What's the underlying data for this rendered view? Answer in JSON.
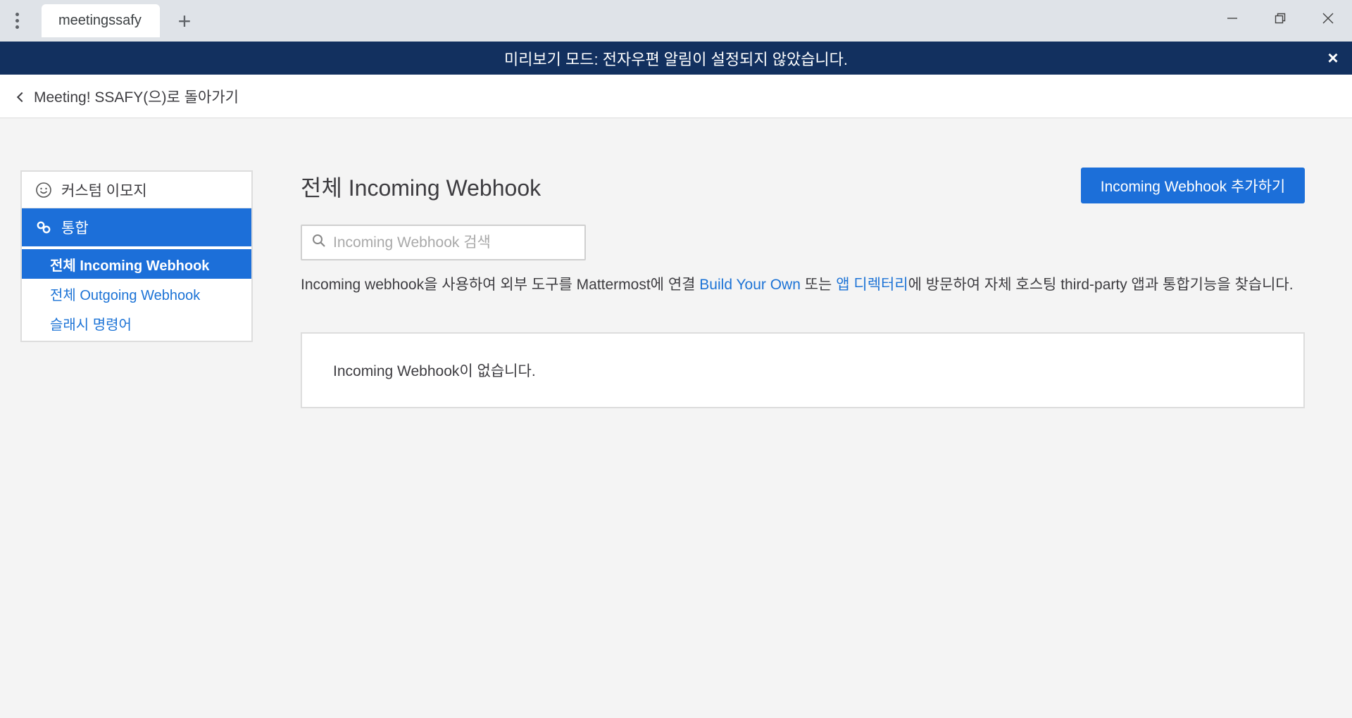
{
  "window": {
    "tab_title": "meetingssafy",
    "new_tab_symbol": "+"
  },
  "banner": {
    "text": "미리보기 모드: 전자우편 알림이 설정되지 않았습니다.",
    "close_symbol": "×"
  },
  "backbar": {
    "label": "Meeting! SSAFY(으)로 돌아가기"
  },
  "sidebar": {
    "items": [
      {
        "label": "커스텀 이모지",
        "icon": "smiley-icon",
        "active": false
      },
      {
        "label": "통합",
        "icon": "link-icon",
        "active": true
      }
    ],
    "subitems": [
      {
        "label": "전체 Incoming Webhook",
        "active": true
      },
      {
        "label": "전체 Outgoing Webhook",
        "active": false
      },
      {
        "label": "슬래시 명령어",
        "active": false
      }
    ]
  },
  "main": {
    "title": "전체 Incoming Webhook",
    "add_button": "Incoming Webhook 추가하기",
    "search_placeholder": "Incoming Webhook 검색",
    "description": {
      "part1": "Incoming webhook을 사용하여 외부 도구를 Mattermost에 연결 ",
      "link1": "Build Your Own",
      "part2": " 또는 ",
      "link2": "앱 디렉터리",
      "part3": "에 방문하여 자체 호스팅 third-party 앱과 통합기능을 찾습니다."
    },
    "empty_message": "Incoming Webhook이 없습니다."
  },
  "colors": {
    "banner_bg": "#12305f",
    "accent": "#1c6fd9",
    "link": "#1c73d6",
    "page_bg": "#f4f4f4"
  }
}
